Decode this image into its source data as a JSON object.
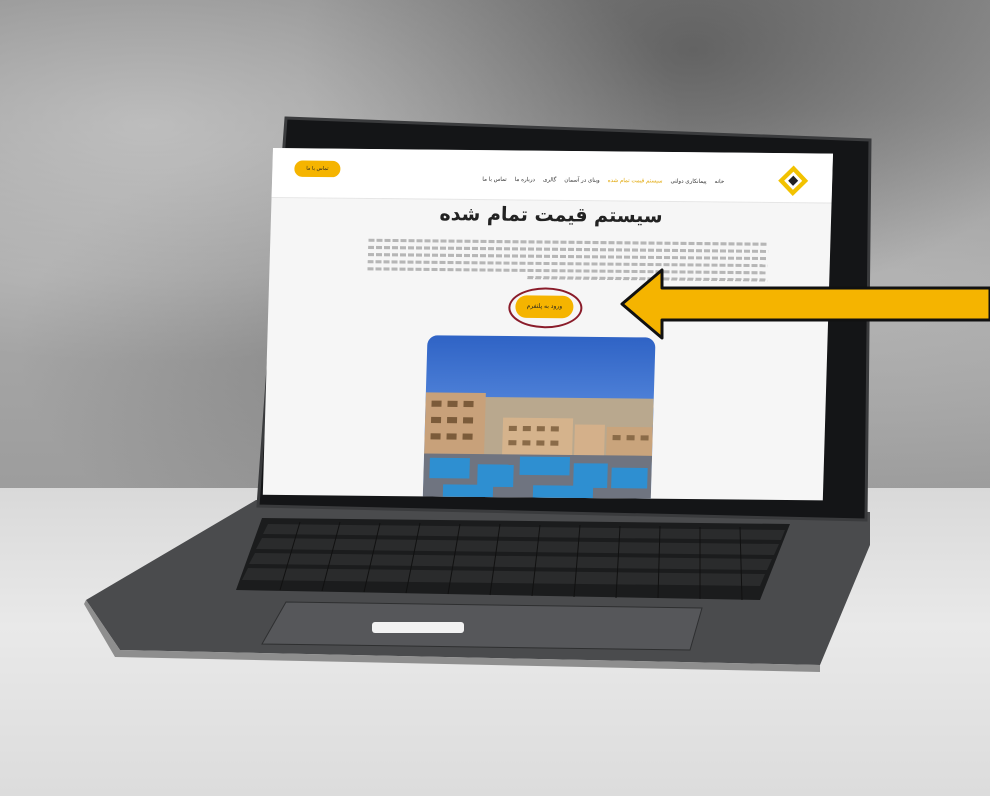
{
  "site": {
    "top_button": "تماس با ما",
    "nav": [
      {
        "label": "خانه",
        "active": false
      },
      {
        "label": "پیمانکاری دولتی",
        "active": false
      },
      {
        "label": "سیستم قیمت تمام شده",
        "active": true
      },
      {
        "label": "وبنای در آسمان",
        "active": false
      },
      {
        "label": "گالری",
        "active": false
      },
      {
        "label": "درباره ما",
        "active": false
      },
      {
        "label": "تماس با ما",
        "active": false
      }
    ],
    "page_title": "سیستم قیمت تمام شده",
    "enter_button": "ورود به پلتفرم",
    "photo_icon": "construction-site-photo",
    "logo_icon": "yellow-diamond-logo"
  },
  "annotation": {
    "arrow_icon": "left-arrow",
    "arrow_color": "#f5b400",
    "highlight_color": "#8a1c2a"
  },
  "colors": {
    "accent": "#f5b400",
    "laptop_body": "#3a3b3d",
    "desk": "#e3e3e3"
  }
}
